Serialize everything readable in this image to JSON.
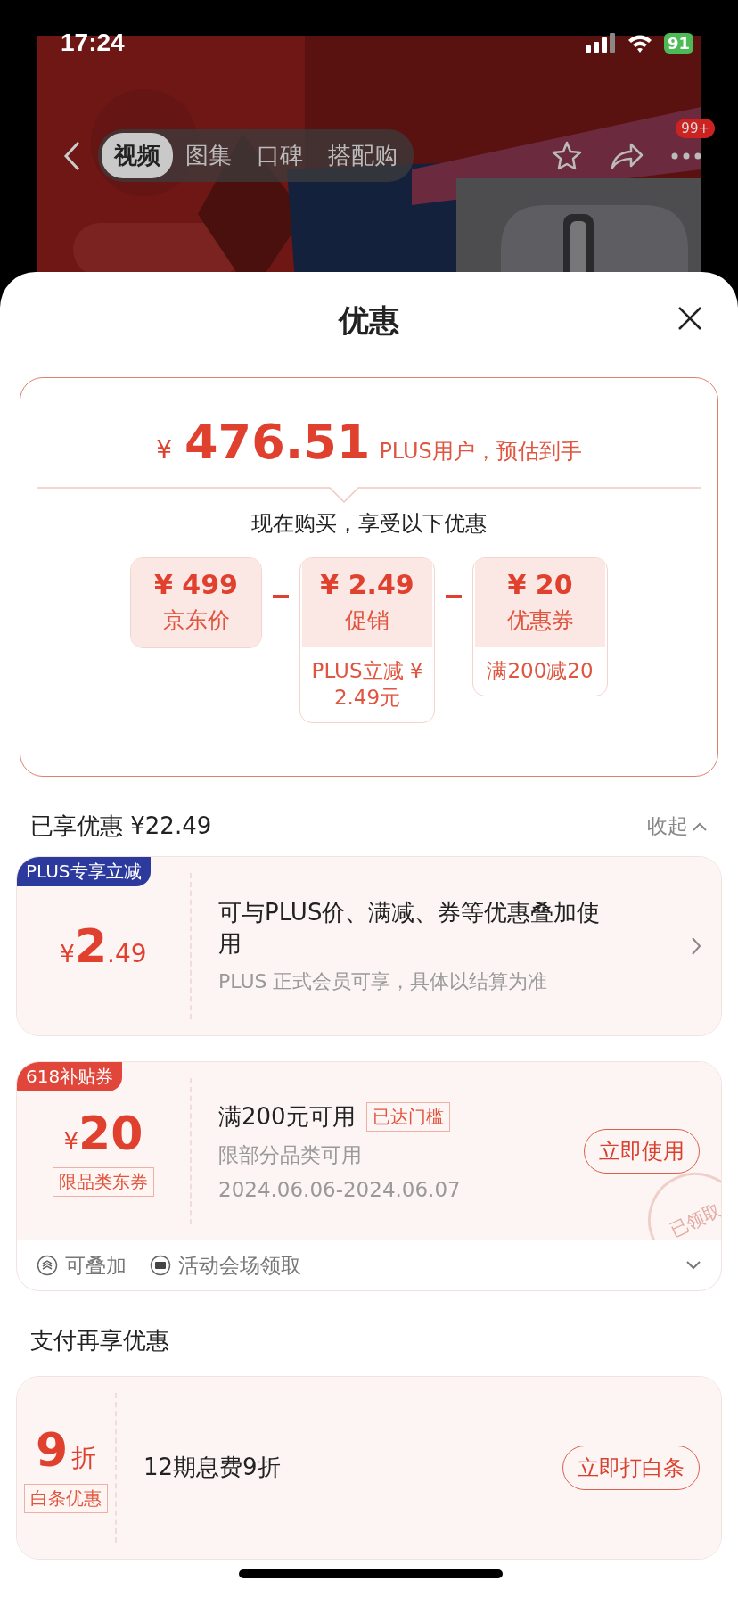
{
  "status_bar": {
    "time": "17:24",
    "battery": "91"
  },
  "nav": {
    "tabs": [
      {
        "label": "视频",
        "selected": true
      },
      {
        "label": "图集",
        "selected": false
      },
      {
        "label": "口碑",
        "selected": false
      },
      {
        "label": "搭配购",
        "selected": false
      }
    ],
    "badge": "99+"
  },
  "sheet": {
    "title": "优惠"
  },
  "estimate": {
    "currency": "¥",
    "price": "476.51",
    "note": "PLUS用户，预估到手",
    "subtitle": "现在购买，享受以下优惠",
    "parts": [
      {
        "currency": "¥",
        "amount": "499",
        "label": "京东价"
      },
      {
        "currency": "¥",
        "amount": "2.49",
        "label": "促销",
        "detail": "PLUS立减 ¥ 2.49元"
      },
      {
        "currency": "¥",
        "amount": "20",
        "label": "优惠券",
        "detail": "满200减20"
      }
    ]
  },
  "applied": {
    "heading": "已享优惠 ¥22.49",
    "toggle": "收起",
    "expanded": true
  },
  "coupons": [
    {
      "kind": "offer",
      "tag": "PLUS专享立减",
      "color": "#2c3a9e",
      "currency": "¥",
      "amount": "2",
      "fraction": ".49",
      "title": "可与PLUS价、满减、券等优惠叠加使用",
      "note": "PLUS 正式会员可享，具体以结算为准"
    },
    {
      "kind": "voucher",
      "tag": "618补贴券",
      "color": "#e0463a",
      "currency": "¥",
      "amount": "20",
      "badge": "限品类东券",
      "title": "满200元可用",
      "status": "已达门槛",
      "lines": [
        "限部分品类可用",
        "2024.06.06-2024.06.07"
      ],
      "button": "立即使用",
      "stamp": "已领取",
      "footer": [
        "可叠加",
        "活动会场领取"
      ],
      "expanded": false
    }
  ],
  "payment": {
    "heading": "支付再享优惠",
    "offers": [
      {
        "amount": "9",
        "unit": "折",
        "badge": "白条优惠",
        "title": "12期息费9折",
        "button": "立即打白条"
      }
    ]
  }
}
